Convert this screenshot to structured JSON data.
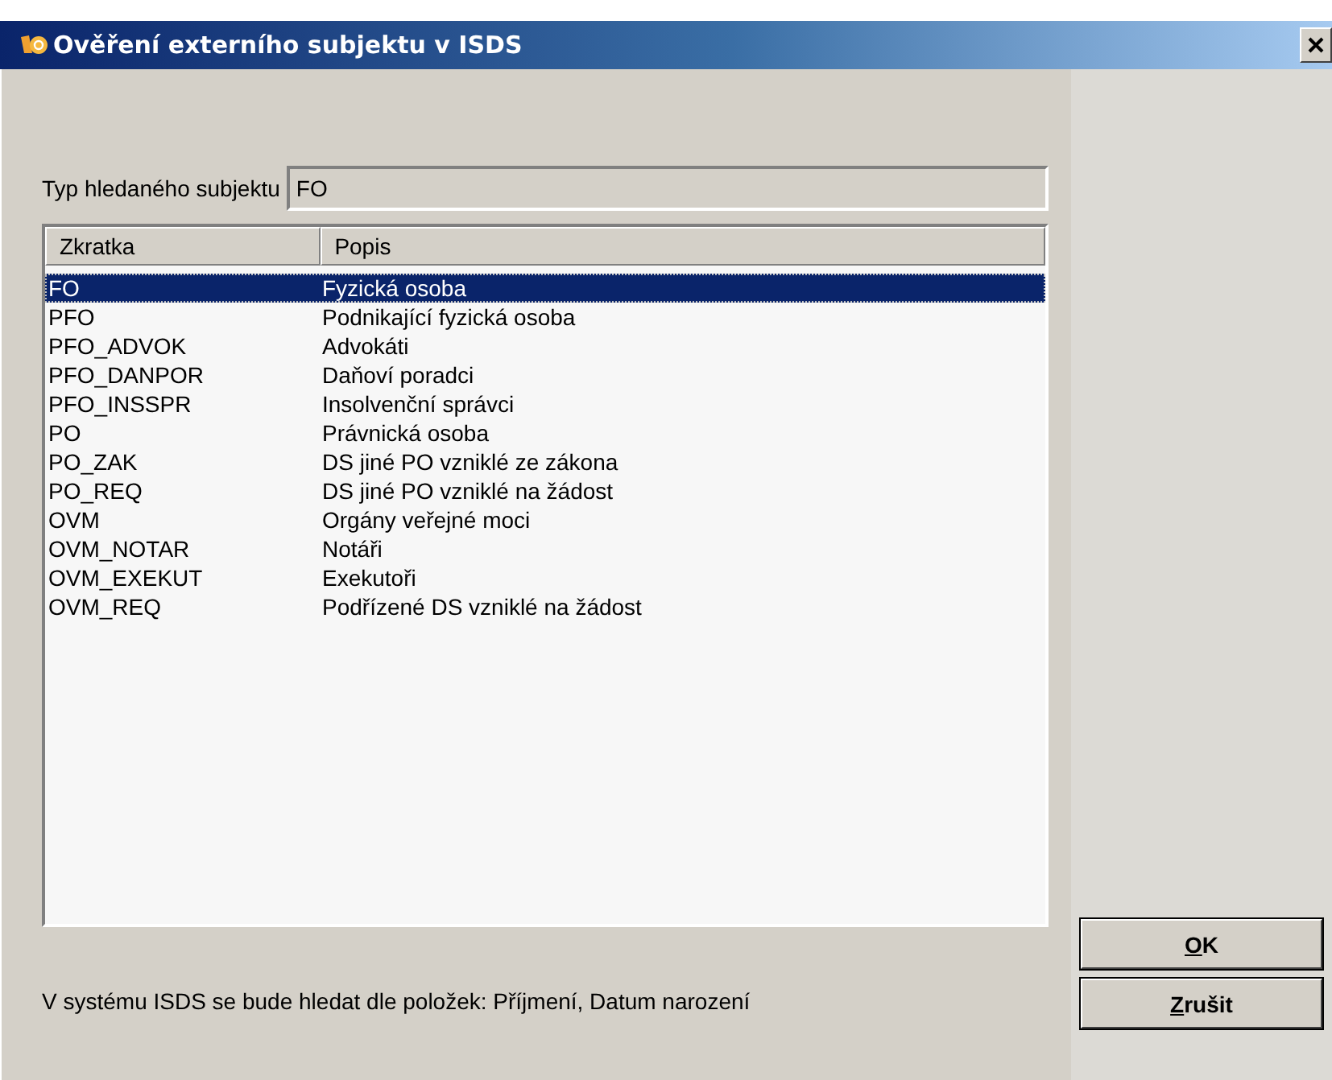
{
  "window": {
    "title": "Ověření externího subjektu v ISDS"
  },
  "type_field": {
    "label": "Typ hledaného subjektu",
    "value": "FO"
  },
  "table": {
    "columns": [
      "Zkratka",
      "Popis"
    ],
    "rows": [
      {
        "code": "FO",
        "description": "Fyzická osoba",
        "selected": true
      },
      {
        "code": "PFO",
        "description": "Podnikající fyzická osoba",
        "selected": false
      },
      {
        "code": "PFO_ADVOK",
        "description": "Advokáti",
        "selected": false
      },
      {
        "code": "PFO_DANPOR",
        "description": "Daňoví poradci",
        "selected": false
      },
      {
        "code": "PFO_INSSPR",
        "description": "Insolvenční správci",
        "selected": false
      },
      {
        "code": "PO",
        "description": "Právnická osoba",
        "selected": false
      },
      {
        "code": "PO_ZAK",
        "description": "DS jiné PO vzniklé ze zákona",
        "selected": false
      },
      {
        "code": "PO_REQ",
        "description": "DS jiné PO vzniklé na žádost",
        "selected": false
      },
      {
        "code": "OVM",
        "description": "Orgány veřejné moci",
        "selected": false
      },
      {
        "code": "OVM_NOTAR",
        "description": "Notáři",
        "selected": false
      },
      {
        "code": "OVM_EXEKUT",
        "description": "Exekutoři",
        "selected": false
      },
      {
        "code": "OVM_REQ",
        "description": "Podřízené DS vzniklé na žádost",
        "selected": false
      }
    ]
  },
  "info": "V systému ISDS se bude hledat dle položek: Příjmení, Datum narození",
  "buttons": [
    {
      "label": "OK",
      "underlined_first_letter": true
    },
    {
      "label": "Zrušit",
      "underlined_first_letter": true
    }
  ]
}
